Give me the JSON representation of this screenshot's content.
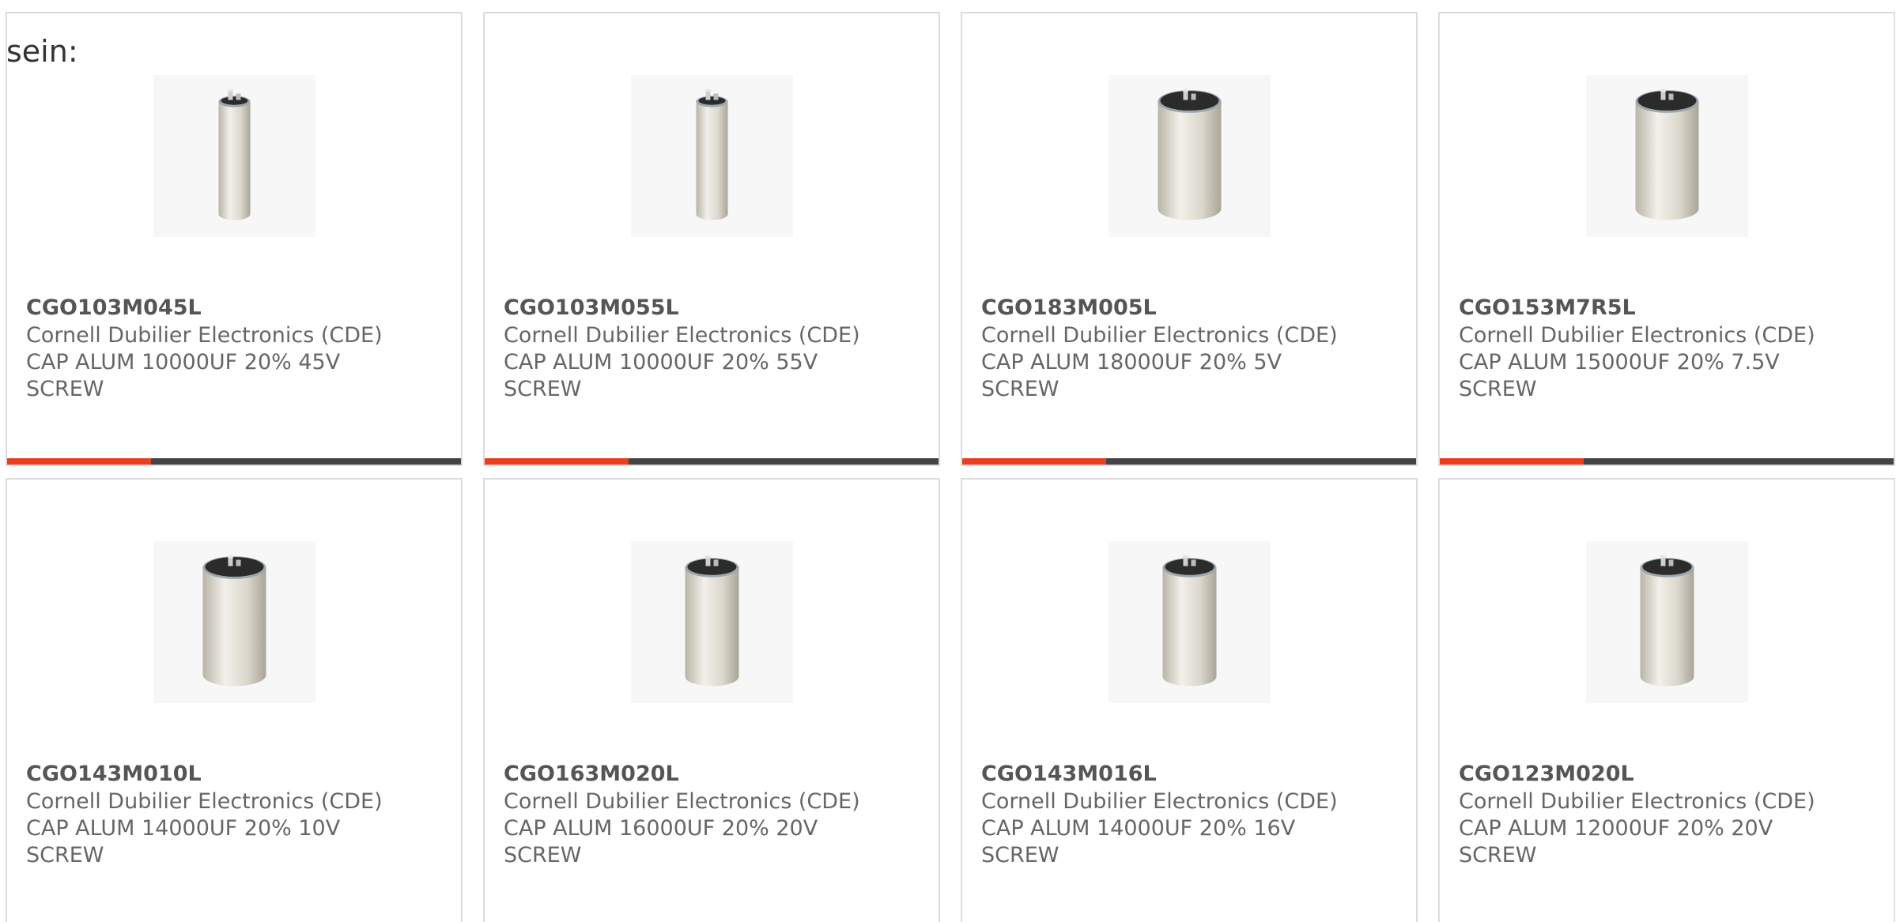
{
  "intro_text": "sein:",
  "colors": {
    "accent": "#e8401c",
    "bar": "#444444",
    "border": "#dcdcdc",
    "text": "#666666"
  },
  "products": [
    {
      "part": "CGO103M045L",
      "manufacturer": "Cornell Dubilier Electronics (CDE)",
      "description": "CAP ALUM 10000UF 20% 45V",
      "mounting": "SCREW",
      "icon": "capacitor-image",
      "shape": "tall"
    },
    {
      "part": "CGO103M055L",
      "manufacturer": "Cornell Dubilier Electronics (CDE)",
      "description": "CAP ALUM 10000UF 20% 55V",
      "mounting": "SCREW",
      "icon": "capacitor-image",
      "shape": "tall"
    },
    {
      "part": "CGO183M005L",
      "manufacturer": "Cornell Dubilier Electronics (CDE)",
      "description": "CAP ALUM 18000UF 20% 5V",
      "mounting": "SCREW",
      "icon": "capacitor-image",
      "shape": "wide"
    },
    {
      "part": "CGO153M7R5L",
      "manufacturer": "Cornell Dubilier Electronics (CDE)",
      "description": "CAP ALUM 15000UF 20% 7.5V",
      "mounting": "SCREW",
      "icon": "capacitor-image",
      "shape": "wide"
    },
    {
      "part": "CGO143M010L",
      "manufacturer": "Cornell Dubilier Electronics (CDE)",
      "description": "CAP ALUM 14000UF 20% 10V",
      "mounting": "SCREW",
      "icon": "capacitor-image",
      "shape": "wide"
    },
    {
      "part": "CGO163M020L",
      "manufacturer": "Cornell Dubilier Electronics (CDE)",
      "description": "CAP ALUM 16000UF 20% 20V",
      "mounting": "SCREW",
      "icon": "capacitor-image",
      "shape": "medium"
    },
    {
      "part": "CGO143M016L",
      "manufacturer": "Cornell Dubilier Electronics (CDE)",
      "description": "CAP ALUM 14000UF 20% 16V",
      "mounting": "SCREW",
      "icon": "capacitor-image",
      "shape": "medium"
    },
    {
      "part": "CGO123M020L",
      "manufacturer": "Cornell Dubilier Electronics (CDE)",
      "description": "CAP ALUM 12000UF 20% 20V",
      "mounting": "SCREW",
      "icon": "capacitor-image",
      "shape": "medium"
    }
  ]
}
